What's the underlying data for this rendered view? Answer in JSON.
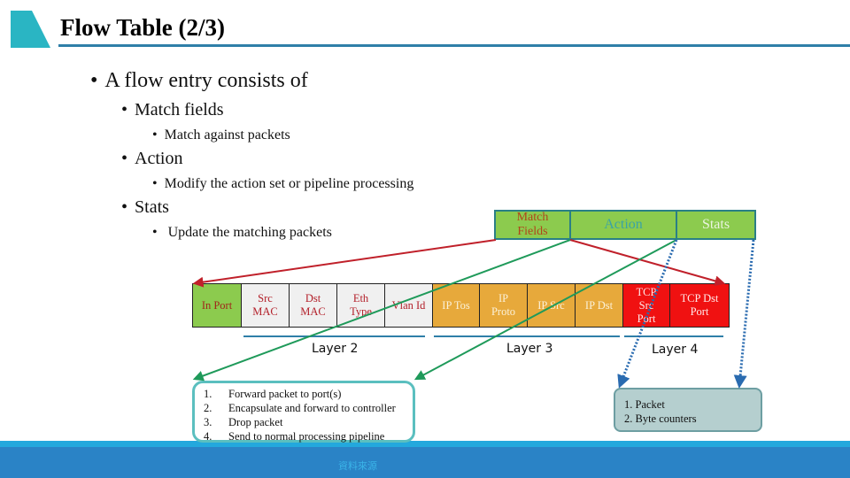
{
  "slide": {
    "title": "Flow Table (2/3)",
    "accent_color": "#2ab5c3",
    "bullets": {
      "level1": "A flow entry consists of",
      "match_fields": "Match fields",
      "match_fields_sub": "Match against packets",
      "action": "Action",
      "action_sub": "Modify the action set or pipeline processing",
      "stats": "Stats",
      "stats_sub": "Update the matching packets",
      "bullet_glyph": "•"
    }
  },
  "flow_entry_header": {
    "match_fields": "Match Fields",
    "action": "Action",
    "stats": "Stats"
  },
  "match_fields": [
    {
      "label": "In Port",
      "group": "port"
    },
    {
      "label": "Src MAC",
      "group": "layer2"
    },
    {
      "label": "Dst MAC",
      "group": "layer2"
    },
    {
      "label": "Eth Type",
      "group": "layer2"
    },
    {
      "label": "Vlan Id",
      "group": "layer2"
    },
    {
      "label": "IP Tos",
      "group": "layer3"
    },
    {
      "label": "IP Proto",
      "group": "layer3"
    },
    {
      "label": "IP Src",
      "group": "layer3"
    },
    {
      "label": "IP Dst",
      "group": "layer3"
    },
    {
      "label": "TCP Src Port",
      "group": "layer4"
    },
    {
      "label": "TCP Dst Port",
      "group": "layer4"
    }
  ],
  "layers": {
    "layer2": "Layer 2",
    "layer3": "Layer 3",
    "layer4": "Layer 4"
  },
  "actions": [
    {
      "num": "1.",
      "text": "Forward packet to port(s)"
    },
    {
      "num": "2.",
      "text": "Encapsulate and forward to controller"
    },
    {
      "num": "3.",
      "text": "Drop packet"
    },
    {
      "num": "4.",
      "text": "Send to normal processing pipeline"
    }
  ],
  "stats": [
    "1. Packet",
    "2. Byte counters"
  ],
  "footer": {
    "source_label": "資料來源"
  },
  "colors": {
    "match_line": "#c0202a",
    "action_line": "#1f9a5a",
    "stats_line": "#2a6bb0",
    "header_fill": "#8ccb4e",
    "layer3_fill": "#e7a93b",
    "layer4_fill": "#f01111"
  }
}
